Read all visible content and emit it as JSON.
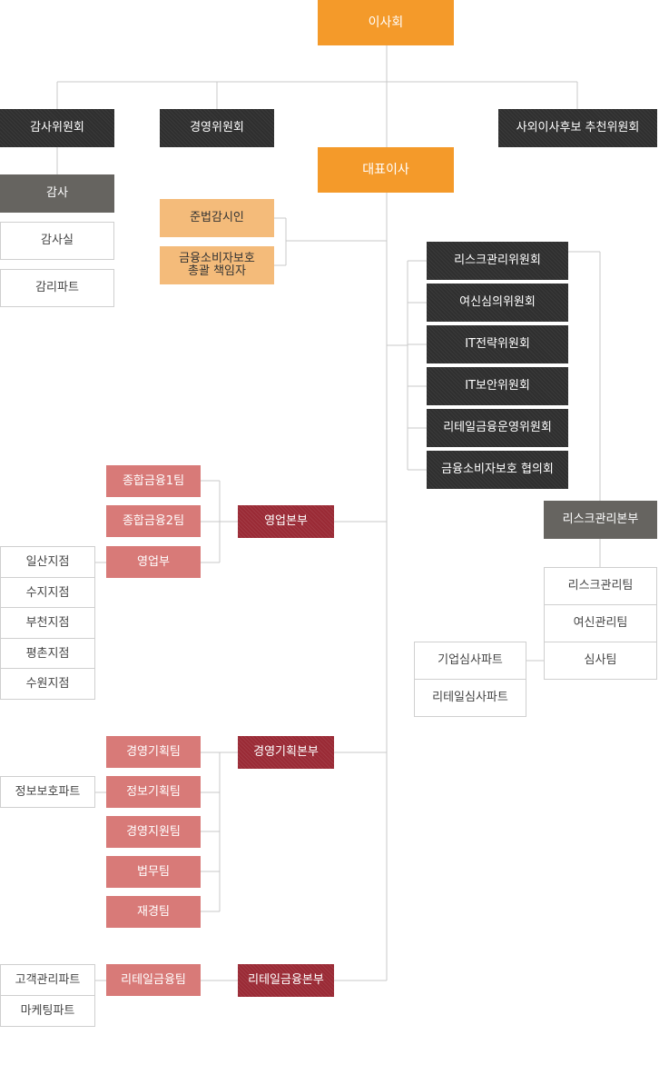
{
  "top": {
    "board": "이사회",
    "audit_committee": "감사위원회",
    "management_committee": "경영위원회",
    "nomination_committee": "사외이사후보 추천위원회",
    "ceo": "대표이사"
  },
  "audit": {
    "head": "감사",
    "units": [
      "감사실",
      "감리파트"
    ]
  },
  "compliance": {
    "officer": "준법감시인",
    "consumer_line1": "금융소비자보호",
    "consumer_line2": "총괄 책임자"
  },
  "committees": [
    "리스크관리위원회",
    "여신심의위원회",
    "IT전략위원회",
    "IT보안위원회",
    "리테일금융운영위원회",
    "금융소비자보호 협의회"
  ],
  "risk": {
    "division": "리스크관리본부",
    "teams": [
      "리스크관리팀",
      "여신관리팀",
      "심사팀"
    ],
    "review_parts": [
      "기업심사파트",
      "리테일심사파트"
    ]
  },
  "sales": {
    "division": "영업본부",
    "teams": [
      "종합금융1팀",
      "종합금융2팀",
      "영업부"
    ],
    "branches": [
      "일산지점",
      "수지지점",
      "부천지점",
      "평촌지점",
      "수원지점"
    ]
  },
  "planning": {
    "division": "경영기획본부",
    "teams": [
      "경영기획팀",
      "정보기획팀",
      "경영지원팀",
      "법무팀",
      "재경팀"
    ],
    "info_protection": "정보보호파트"
  },
  "retail": {
    "division": "리테일금융본부",
    "team": "리테일금융팀",
    "parts": [
      "고객관리파트",
      "마케팅파트"
    ]
  }
}
